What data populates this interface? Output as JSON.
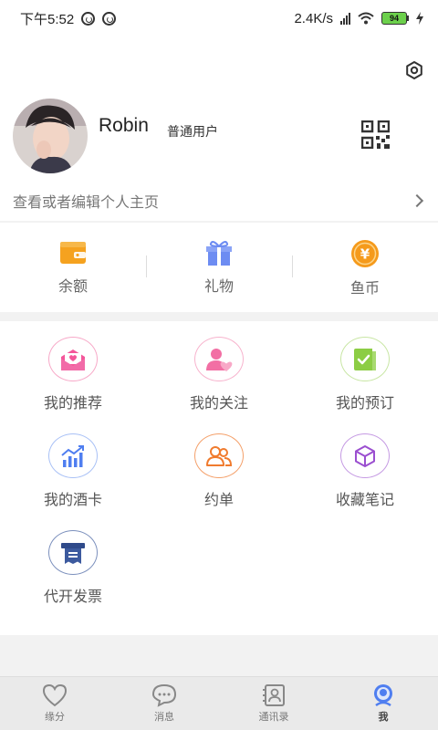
{
  "status_bar": {
    "time": "下午5:52",
    "net_speed": "2.4K/s",
    "battery": "94"
  },
  "profile": {
    "name": "Robin",
    "user_type": "普通用户",
    "edit_label": "查看或者编辑个人主页"
  },
  "wallet": [
    {
      "label": "余额",
      "icon": "wallet-icon",
      "color": "#f5a21f"
    },
    {
      "label": "礼物",
      "icon": "gift-icon",
      "color": "#6d8cf2"
    },
    {
      "label": "鱼币",
      "icon": "coin-icon",
      "color": "#f59a1b"
    }
  ],
  "menu": [
    {
      "label": "我的推荐",
      "icon": "recommend-mail-icon",
      "color": "#f4569a"
    },
    {
      "label": "我的关注",
      "icon": "follow-user-icon",
      "color": "#f26fa4"
    },
    {
      "label": "我的预订",
      "icon": "booking-check-icon",
      "color": "#8ccd44"
    },
    {
      "label": "我的酒卡",
      "icon": "wine-card-chart-icon",
      "color": "#4f7ef0"
    },
    {
      "label": "约单",
      "icon": "group-order-icon",
      "color": "#f07b2e"
    },
    {
      "label": "收藏笔记",
      "icon": "favorites-cube-icon",
      "color": "#9b4fd0"
    },
    {
      "label": "代开发票",
      "icon": "invoice-icon",
      "color": "#2f4a8a"
    }
  ],
  "tabs": [
    {
      "label": "缘分",
      "icon": "heart-icon",
      "active": false
    },
    {
      "label": "消息",
      "icon": "chat-icon",
      "active": false
    },
    {
      "label": "通讯录",
      "icon": "contacts-icon",
      "active": false
    },
    {
      "label": "我",
      "icon": "profile-icon",
      "active": true
    }
  ]
}
